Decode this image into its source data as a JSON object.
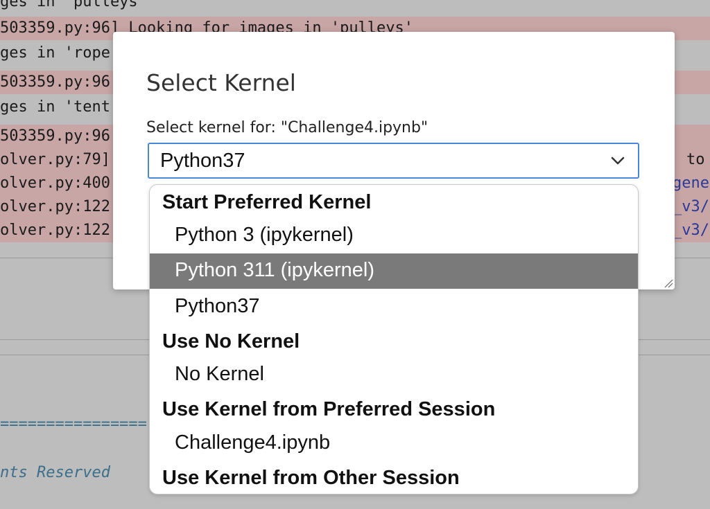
{
  "background": {
    "lines": [
      {
        "text": "ges in 'pulleys'",
        "style": "plain"
      },
      {
        "text": "503359.py:96] Looking for images in 'pulleys'",
        "style": "warn"
      },
      {
        "text": "ges in 'rope",
        "style": "plain"
      },
      {
        "text": "503359.py:96",
        "style": "warn"
      },
      {
        "text": "ges in 'tent",
        "style": "plain"
      },
      {
        "text": "503359.py:96",
        "style": "warn"
      },
      {
        "text": "olver.py:79]",
        "style": "warn"
      },
      {
        "text": "olver.py:400",
        "style": "warn"
      },
      {
        "text": "olver.py:122",
        "style": "warn"
      },
      {
        "text": "olver.py:122",
        "style": "warn"
      }
    ],
    "right_fragments": [
      "to",
      "gene",
      "_v3/",
      "_v3/"
    ],
    "separator_text": "================",
    "footer_text": "nts Reserved"
  },
  "dialog": {
    "title": "Select Kernel",
    "subtitle": "Select kernel for: \"Challenge4.ipynb\"",
    "selected_value": "Python37",
    "groups": [
      {
        "label": "Start Preferred Kernel",
        "options": [
          "Python 3 (ipykernel)",
          "Python 311 (ipykernel)",
          "Python37"
        ]
      },
      {
        "label": "Use No Kernel",
        "options": [
          "No Kernel"
        ]
      },
      {
        "label": "Use Kernel from Preferred Session",
        "options": [
          "Challenge4.ipynb"
        ]
      },
      {
        "label": "Use Kernel from Other Session",
        "options": []
      }
    ],
    "highlighted_option": "Python 311 (ipykernel)",
    "chevron_icon": "chevron-down-icon"
  },
  "colors": {
    "accent": "#4a86d8",
    "highlight": "#7a7a7a",
    "warning_bg": "#c9a6a6"
  }
}
